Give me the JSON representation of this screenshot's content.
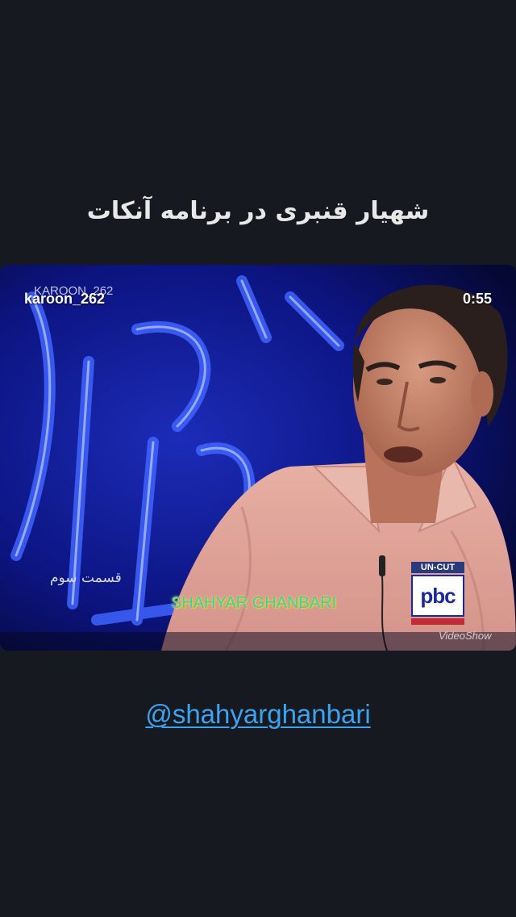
{
  "caption": "شهیار قنبری در برنامه آنکات",
  "video": {
    "account_handle": "karoon_262",
    "ghost_handle": "KAROON_262",
    "timer": "0:55",
    "episode_label": "قسمت سوم",
    "name_overlay": "SHAHYAR GHANBARI",
    "channel_logo": {
      "top_text": "UN-CUT",
      "main_text": "pbc"
    },
    "watermark": "VideoShow"
  },
  "mention": "@shahyarghanbari",
  "colors": {
    "background": "#161a20",
    "mention": "#3ca3f0",
    "video_background": "#0a0f6e",
    "name_overlay": "#2fd4b8"
  }
}
